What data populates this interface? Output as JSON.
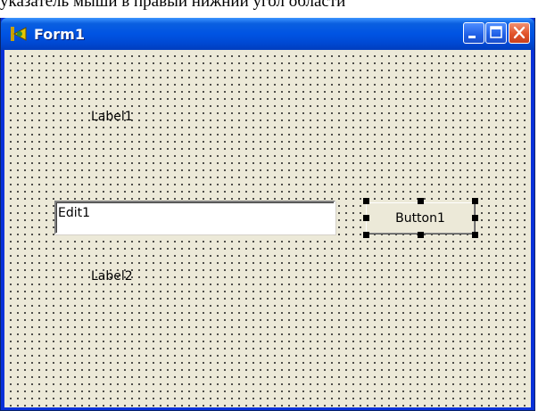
{
  "top_caption": "указатель мыши в правый нижний угол области",
  "window": {
    "title": "Form1",
    "icon": "delphi-app-icon"
  },
  "titlebar_buttons": {
    "minimize": "minimize-icon",
    "maximize": "maximize-icon",
    "close": "close-icon"
  },
  "form": {
    "label1": "Label1",
    "label2": "Label2",
    "edit1": "Edit1",
    "button1": "Button1"
  },
  "colors": {
    "titlebar": "#0054e3",
    "close_button": "#e2542a",
    "client_background": "#ece9d8"
  }
}
